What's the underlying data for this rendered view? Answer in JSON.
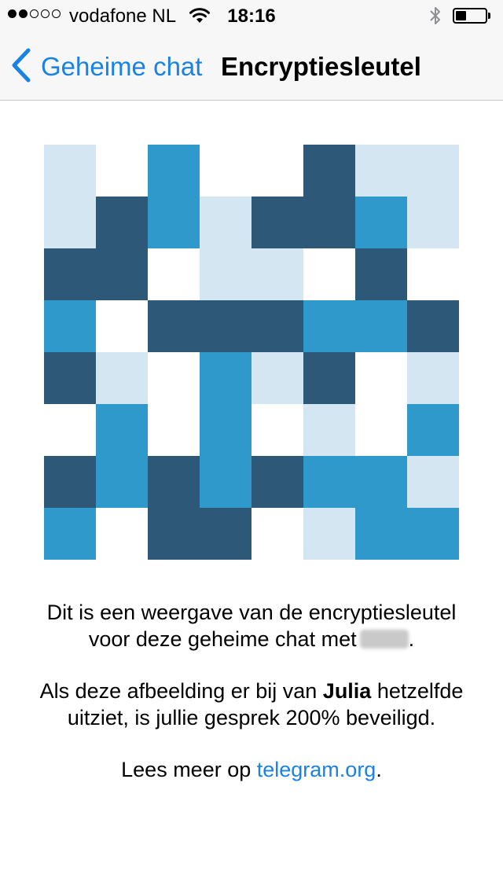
{
  "status_bar": {
    "carrier": "vodafone NL",
    "time": "18:16",
    "signal_bars_filled": 2,
    "signal_bars_total": 5,
    "battery_level": 0.35,
    "icons": [
      "signal-dots-icon",
      "wifi-icon",
      "bluetooth-icon",
      "battery-icon"
    ]
  },
  "nav": {
    "back_label": "Geheime chat",
    "title": "Encryptiesleutel"
  },
  "colors": {
    "accent": "#1a82e2",
    "key_palette": [
      "#ffffff",
      "#d5e6f3",
      "#2f99cc",
      "#2e5877"
    ]
  },
  "key_grid": [
    [
      1,
      0,
      2,
      0,
      0,
      3,
      1,
      1
    ],
    [
      1,
      3,
      2,
      1,
      3,
      3,
      2,
      1
    ],
    [
      3,
      3,
      0,
      1,
      1,
      0,
      3,
      0
    ],
    [
      2,
      0,
      3,
      3,
      3,
      2,
      2,
      3
    ],
    [
      3,
      1,
      0,
      2,
      1,
      3,
      0,
      1
    ],
    [
      0,
      2,
      0,
      2,
      0,
      1,
      0,
      2
    ],
    [
      3,
      2,
      3,
      2,
      3,
      2,
      2,
      1
    ],
    [
      2,
      0,
      3,
      3,
      0,
      1,
      2,
      2
    ]
  ],
  "description": {
    "line1": "Dit is een weergave van de encryptiesleutel",
    "line2": "voor deze geheime chat met",
    "line2_end": ".",
    "p2_before": "Als deze afbeelding er bij van ",
    "p2_name": "Julia",
    "p2_after": " hetzelfde",
    "p2_line2": "uitziet, is jullie gesprek 200% beveiligd.",
    "p3_before": "Lees meer op ",
    "p3_link": "telegram.org",
    "p3_after": "."
  }
}
